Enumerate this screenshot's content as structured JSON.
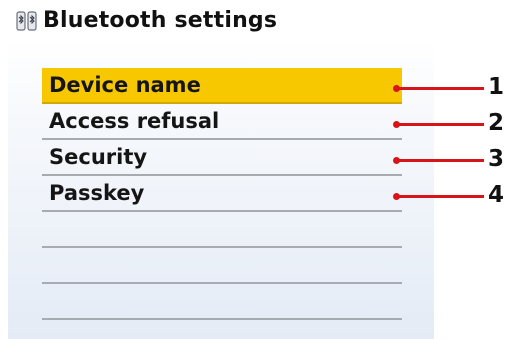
{
  "header": {
    "title": "Bluetooth settings",
    "icon": "bluetooth-settings-icon"
  },
  "menu": {
    "items": [
      {
        "label": "Device name",
        "selected": true
      },
      {
        "label": "Access refusal",
        "selected": false
      },
      {
        "label": "Security",
        "selected": false
      },
      {
        "label": "Passkey",
        "selected": false
      },
      {
        "label": "",
        "selected": false
      },
      {
        "label": "",
        "selected": false
      },
      {
        "label": "",
        "selected": false
      }
    ]
  },
  "callouts": [
    "1",
    "2",
    "3",
    "4"
  ],
  "colors": {
    "highlight": "#f7c800",
    "callout_line": "#d8141b",
    "divider": "#a8aab2"
  }
}
